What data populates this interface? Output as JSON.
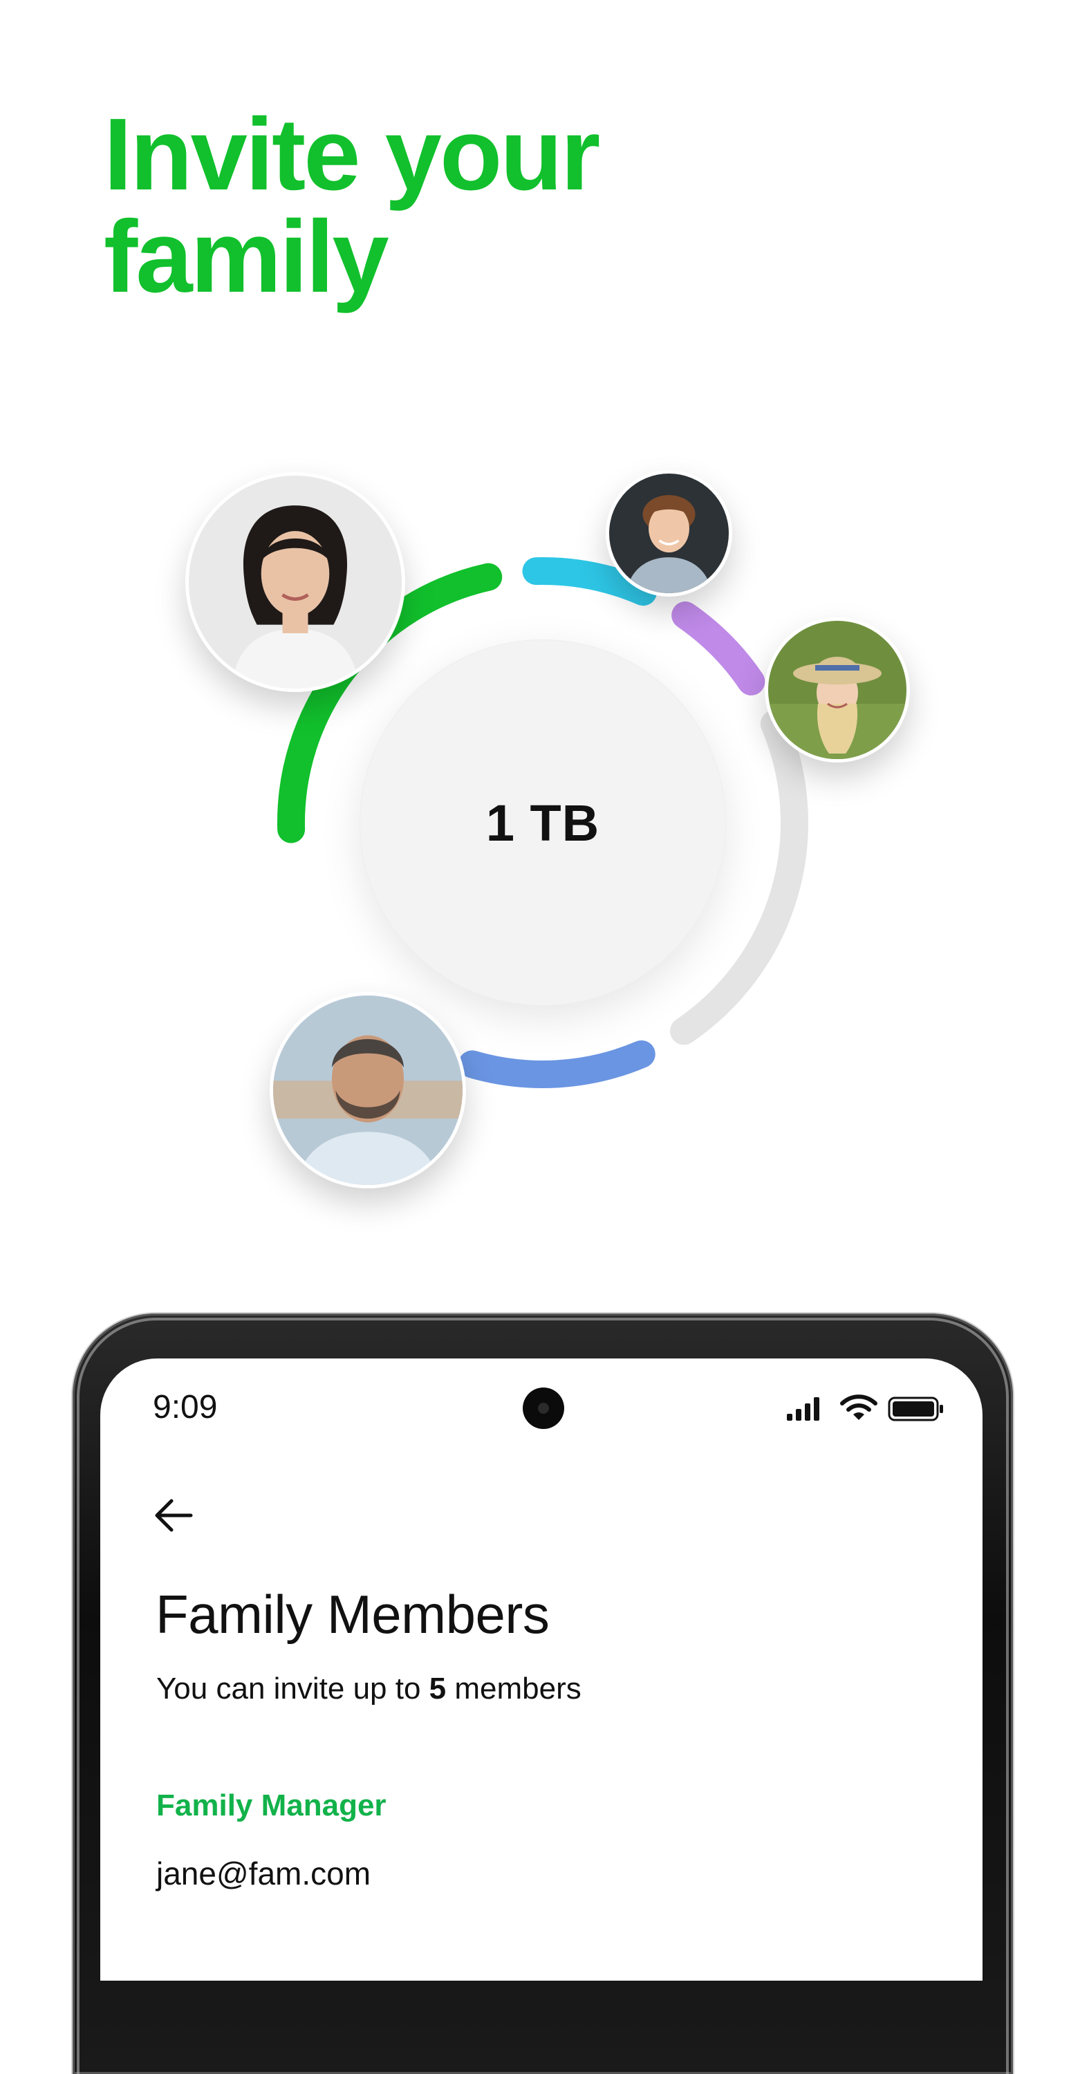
{
  "headline": {
    "line1": "Invite your",
    "line2": "family"
  },
  "storage": {
    "capacity": "1 TB",
    "segments": [
      {
        "member": "avatar-woman-dark-hair",
        "color": "#11c02c",
        "share": 0.25
      },
      {
        "member": "avatar-young-man-curly",
        "color": "#2ec6e6",
        "share": 0.1
      },
      {
        "member": "avatar-woman-hat",
        "color": "#bf8ae8",
        "share": 0.09
      },
      {
        "member": "unused",
        "color": "#e4e4e4",
        "share": 0.25
      },
      {
        "member": "avatar-man-beard",
        "color": "#6a95e2",
        "share": 0.14
      }
    ]
  },
  "colors": {
    "brand_green": "#11c02c",
    "label_green": "#12b24a",
    "text_dark": "#111111"
  },
  "phone": {
    "status_time": "9:09",
    "status_icons": [
      "signal-icon",
      "wifi-icon",
      "battery-icon"
    ],
    "back_icon": "arrow-left-icon",
    "title": "Family Members",
    "subtitle_prefix": "You can invite up to ",
    "subtitle_count": "5",
    "subtitle_suffix": " members",
    "section_label": "Family Manager",
    "manager_email": "jane@fam.com"
  }
}
